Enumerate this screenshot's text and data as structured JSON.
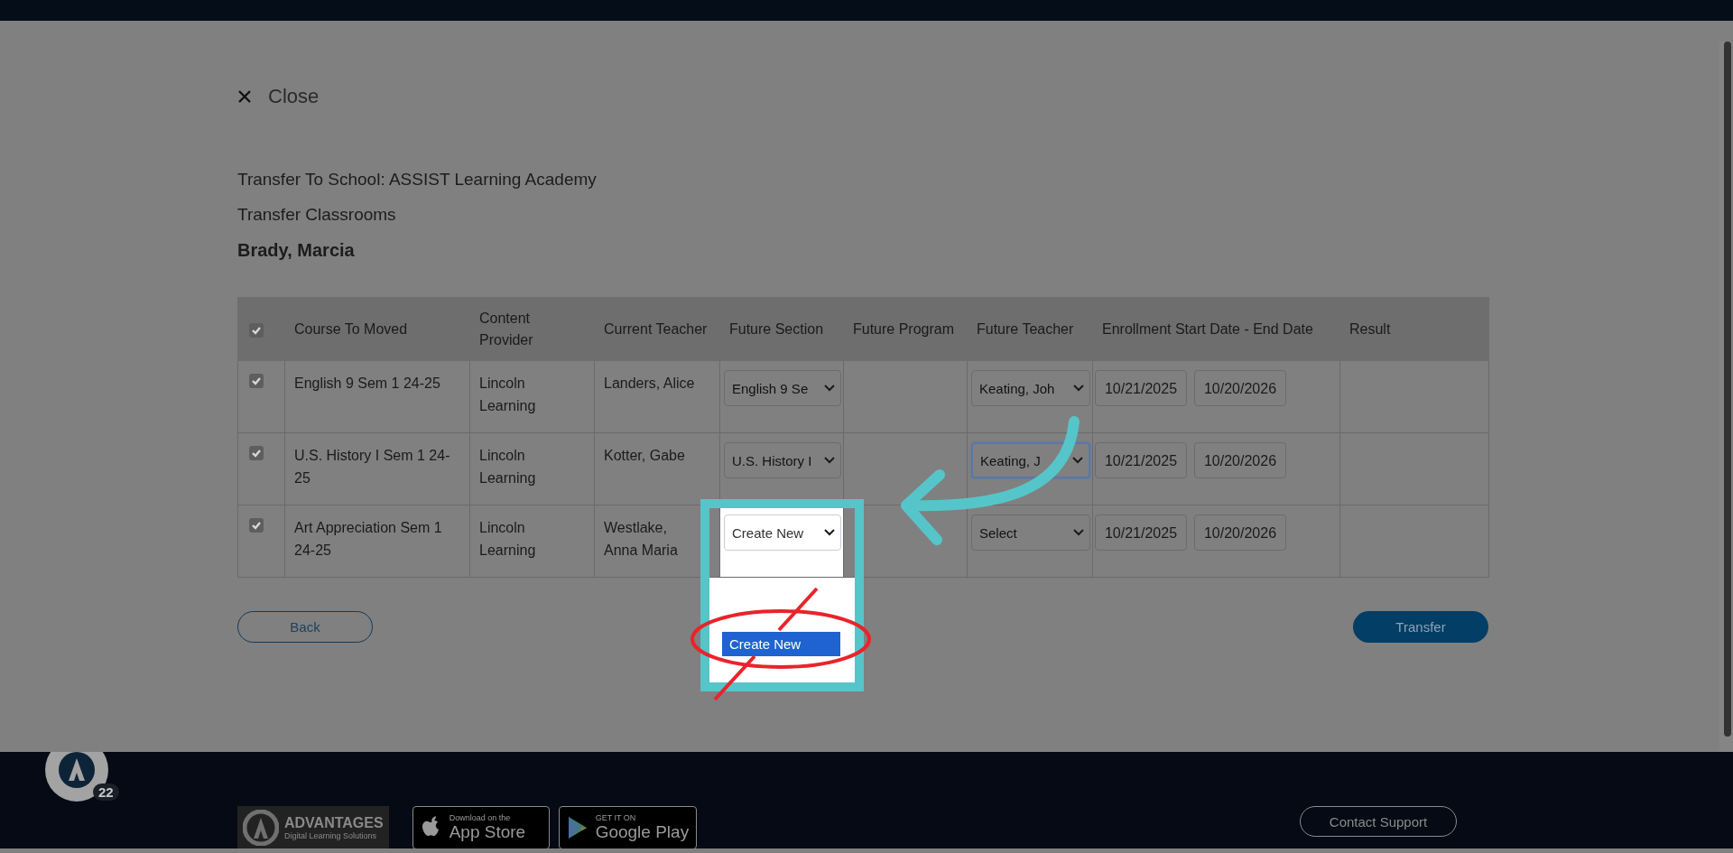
{
  "close": {
    "label": "Close"
  },
  "heading": {
    "school": "Transfer To School: ASSIST Learning Academy",
    "subtitle": "Transfer Classrooms",
    "student": "Brady, Marcia"
  },
  "table": {
    "select_all_checked": true,
    "columns": [
      "Course To Moved",
      "Content Provider",
      "Current Teacher",
      "Future Section",
      "Future Program",
      "Future Teacher",
      "Enrollment Start Date - End Date",
      "Result"
    ],
    "rows": [
      {
        "checked": true,
        "course": "English 9 Sem 1 24-25",
        "provider": "Lincoln Learning",
        "current_teacher": "Landers, Alice",
        "future_section": {
          "value": "English 9 Se",
          "highlighted": false
        },
        "future_teacher": {
          "value": "Keating, Joh",
          "focused": false
        },
        "start_date": "10/21/2025",
        "end_date": "10/20/2026"
      },
      {
        "checked": true,
        "course": "U.S. History I Sem 1 24-25",
        "provider": "Lincoln Learning",
        "current_teacher": "Kotter, Gabe",
        "future_section": {
          "value": "U.S. History I",
          "highlighted": false
        },
        "future_teacher": {
          "value": "Keating, J",
          "focused": true
        },
        "start_date": "10/21/2025",
        "end_date": "10/20/2026"
      },
      {
        "checked": true,
        "course": "Art Appreciation Sem 1 24-25",
        "provider": "Lincoln Learning",
        "current_teacher": "Westlake, Anna Maria",
        "future_section": {
          "value": "Create New",
          "highlighted": true
        },
        "future_teacher": {
          "value": "Select",
          "focused": false
        },
        "start_date": "10/21/2025",
        "end_date": "10/20/2026"
      }
    ]
  },
  "dropdown": {
    "options": [
      {
        "label": "Create New",
        "selected": true
      }
    ]
  },
  "buttons": {
    "back": "Back",
    "transfer": "Transfer"
  },
  "footer": {
    "badge": "22",
    "brand": "ADVANTAGES",
    "tagline": "Digital Learning Solutions",
    "app_store": {
      "small": "Download on the",
      "big": "App Store"
    },
    "google_play": {
      "small": "GET IT ON",
      "big": "Google Play"
    },
    "contact": "Contact Support"
  }
}
